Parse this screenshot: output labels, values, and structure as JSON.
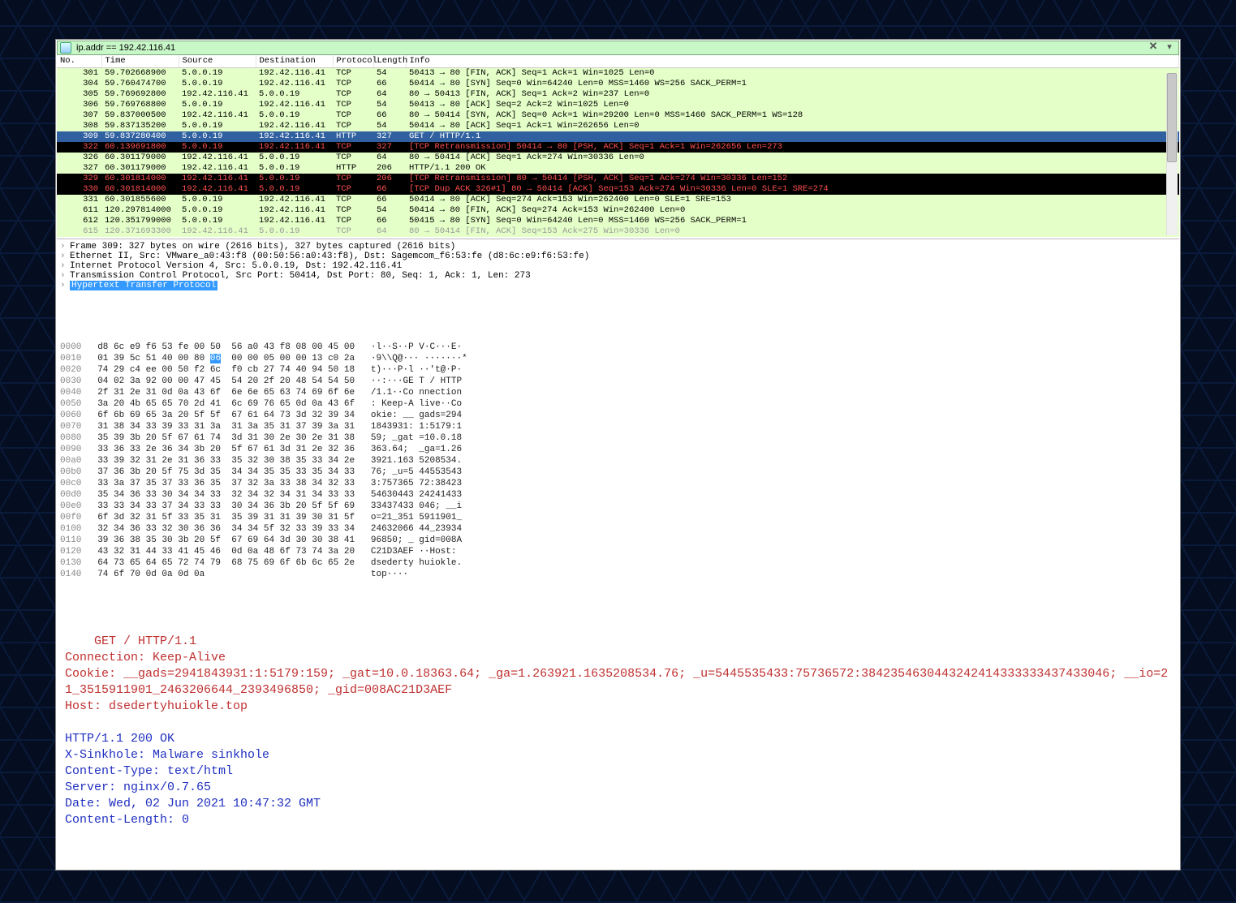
{
  "filter": {
    "text": "ip.addr == 192.42.116.41"
  },
  "columns": {
    "no": "No.",
    "time": "Time",
    "source": "Source",
    "destination": "Destination",
    "protocol": "Protocol",
    "length": "Length",
    "info": "Info"
  },
  "packets": [
    {
      "no": "301",
      "time": "59.702668900",
      "src": "5.0.0.19",
      "dst": "192.42.116.41",
      "proto": "TCP",
      "len": "54",
      "info": "50413 → 80 [FIN, ACK] Seq=1 Ack=1 Win=1025 Len=0",
      "cls": "bg-green"
    },
    {
      "no": "304",
      "time": "59.760474700",
      "src": "5.0.0.19",
      "dst": "192.42.116.41",
      "proto": "TCP",
      "len": "66",
      "info": "50414 → 80 [SYN] Seq=0 Win=64240 Len=0 MSS=1460 WS=256 SACK_PERM=1",
      "cls": "bg-green"
    },
    {
      "no": "305",
      "time": "59.769692800",
      "src": "192.42.116.41",
      "dst": "5.0.0.19",
      "proto": "TCP",
      "len": "64",
      "info": "80 → 50413 [FIN, ACK] Seq=1 Ack=2 Win=237 Len=0",
      "cls": "bg-green"
    },
    {
      "no": "306",
      "time": "59.769768800",
      "src": "5.0.0.19",
      "dst": "192.42.116.41",
      "proto": "TCP",
      "len": "54",
      "info": "50413 → 80 [ACK] Seq=2 Ack=2 Win=1025 Len=0",
      "cls": "bg-green"
    },
    {
      "no": "307",
      "time": "59.837000500",
      "src": "192.42.116.41",
      "dst": "5.0.0.19",
      "proto": "TCP",
      "len": "66",
      "info": "80 → 50414 [SYN, ACK] Seq=0 Ack=1 Win=29200 Len=0 MSS=1460 SACK_PERM=1 WS=128",
      "cls": "bg-green"
    },
    {
      "no": "308",
      "time": "59.837135200",
      "src": "5.0.0.19",
      "dst": "192.42.116.41",
      "proto": "TCP",
      "len": "54",
      "info": "50414 → 80 [ACK] Seq=1 Ack=1 Win=262656 Len=0",
      "cls": "bg-green"
    },
    {
      "no": "309",
      "time": "59.837280400",
      "src": "5.0.0.19",
      "dst": "192.42.116.41",
      "proto": "HTTP",
      "len": "327",
      "info": "GET / HTTP/1.1",
      "cls": "bg-sel"
    },
    {
      "no": "322",
      "time": "60.139691800",
      "src": "5.0.0.19",
      "dst": "192.42.116.41",
      "proto": "TCP",
      "len": "327",
      "info": "[TCP Retransmission] 50414 → 80 [PSH, ACK] Seq=1 Ack=1 Win=262656 Len=273",
      "cls": "bg-black"
    },
    {
      "no": "326",
      "time": "60.301179000",
      "src": "192.42.116.41",
      "dst": "5.0.0.19",
      "proto": "TCP",
      "len": "64",
      "info": "80 → 50414 [ACK] Seq=1 Ack=274 Win=30336 Len=0",
      "cls": "bg-green"
    },
    {
      "no": "327",
      "time": "60.301179000",
      "src": "192.42.116.41",
      "dst": "5.0.0.19",
      "proto": "HTTP",
      "len": "206",
      "info": "HTTP/1.1 200 OK",
      "cls": "bg-green"
    },
    {
      "no": "329",
      "time": "60.301814000",
      "src": "192.42.116.41",
      "dst": "5.0.0.19",
      "proto": "TCP",
      "len": "206",
      "info": "[TCP Retransmission] 80 → 50414 [PSH, ACK] Seq=1 Ack=274 Win=30336 Len=152",
      "cls": "bg-black"
    },
    {
      "no": "330",
      "time": "60.301814000",
      "src": "192.42.116.41",
      "dst": "5.0.0.19",
      "proto": "TCP",
      "len": "66",
      "info": "[TCP Dup ACK 326#1] 80 → 50414 [ACK] Seq=153 Ack=274 Win=30336 Len=0 SLE=1 SRE=274",
      "cls": "bg-black"
    },
    {
      "no": "331",
      "time": "60.301855600",
      "src": "5.0.0.19",
      "dst": "192.42.116.41",
      "proto": "TCP",
      "len": "66",
      "info": "50414 → 80 [ACK] Seq=274 Ack=153 Win=262400 Len=0 SLE=1 SRE=153",
      "cls": "bg-green"
    },
    {
      "no": "611",
      "time": "120.297814000",
      "src": "5.0.0.19",
      "dst": "192.42.116.41",
      "proto": "TCP",
      "len": "54",
      "info": "50414 → 80 [FIN, ACK] Seq=274 Ack=153 Win=262400 Len=0",
      "cls": "bg-green"
    },
    {
      "no": "612",
      "time": "120.351799000",
      "src": "5.0.0.19",
      "dst": "192.42.116.41",
      "proto": "TCP",
      "len": "66",
      "info": "50415 → 80 [SYN] Seq=0 Win=64240 Len=0 MSS=1460 WS=256 SACK_PERM=1",
      "cls": "bg-green"
    },
    {
      "no": "615",
      "time": "120.371693300",
      "src": "192.42.116.41",
      "dst": "5.0.0.19",
      "proto": "TCP",
      "len": "64",
      "info": "80 → 50414 [FIN, ACK] Seq=153 Ack=275 Win=30336 Len=0",
      "cls": "bg-cut"
    }
  ],
  "details": {
    "l0": "Frame 309: 327 bytes on wire (2616 bits), 327 bytes captured (2616 bits)",
    "l1": "Ethernet II, Src: VMware_a0:43:f8 (00:50:56:a0:43:f8), Dst: Sagemcom_f6:53:fe (d8:6c:e9:f6:53:fe)",
    "l2": "Internet Protocol Version 4, Src: 5.0.0.19, Dst: 192.42.116.41",
    "l3": "Transmission Control Protocol, Src Port: 50414, Dst Port: 80, Seq: 1, Ack: 1, Len: 273",
    "l4": "Hypertext Transfer Protocol"
  },
  "hex": [
    {
      "off": "0000",
      "b": "d8 6c e9 f6 53 fe 00 50  56 a0 43 f8 08 00 45 00",
      "a": "·l··S··P V·C···E·"
    },
    {
      "off": "0010",
      "b1": "01 39 5c 51 40 00 80 ",
      "sel": "06",
      "b2": "  00 00 05 00 00 13 c0 2a",
      "a": "·9\\\\Q@··· ·······*"
    },
    {
      "off": "0020",
      "b": "74 29 c4 ee 00 50 f2 6c  f0 cb 27 74 40 94 50 18",
      "a": "t)···P·l ··'t@·P·"
    },
    {
      "off": "0030",
      "b": "04 02 3a 92 00 00 47 45  54 20 2f 20 48 54 54 50",
      "a": "··:···GE T / HTTP"
    },
    {
      "off": "0040",
      "b": "2f 31 2e 31 0d 0a 43 6f  6e 6e 65 63 74 69 6f 6e",
      "a": "/1.1··Co nnection"
    },
    {
      "off": "0050",
      "b": "3a 20 4b 65 65 70 2d 41  6c 69 76 65 0d 0a 43 6f",
      "a": ": Keep-A live··Co"
    },
    {
      "off": "0060",
      "b": "6f 6b 69 65 3a 20 5f 5f  67 61 64 73 3d 32 39 34",
      "a": "okie: __ gads=294"
    },
    {
      "off": "0070",
      "b": "31 38 34 33 39 33 31 3a  31 3a 35 31 37 39 3a 31",
      "a": "1843931: 1:5179:1"
    },
    {
      "off": "0080",
      "b": "35 39 3b 20 5f 67 61 74  3d 31 30 2e 30 2e 31 38",
      "a": "59; _gat =10.0.18"
    },
    {
      "off": "0090",
      "b": "33 36 33 2e 36 34 3b 20  5f 67 61 3d 31 2e 32 36",
      "a": "363.64;  _ga=1.26"
    },
    {
      "off": "00a0",
      "b": "33 39 32 31 2e 31 36 33  35 32 30 38 35 33 34 2e",
      "a": "3921.163 5208534."
    },
    {
      "off": "00b0",
      "b": "37 36 3b 20 5f 75 3d 35  34 34 35 35 33 35 34 33",
      "a": "76; _u=5 44553543"
    },
    {
      "off": "00c0",
      "b": "33 3a 37 35 37 33 36 35  37 32 3a 33 38 34 32 33",
      "a": "3:757365 72:38423"
    },
    {
      "off": "00d0",
      "b": "35 34 36 33 30 34 34 33  32 34 32 34 31 34 33 33",
      "a": "54630443 24241433"
    },
    {
      "off": "00e0",
      "b": "33 33 34 33 37 34 33 33  30 34 36 3b 20 5f 5f 69",
      "a": "33437433 046; __i"
    },
    {
      "off": "00f0",
      "b": "6f 3d 32 31 5f 33 35 31  35 39 31 31 39 30 31 5f",
      "a": "o=21_351 5911901_"
    },
    {
      "off": "0100",
      "b": "32 34 36 33 32 30 36 36  34 34 5f 32 33 39 33 34",
      "a": "24632066 44_23934"
    },
    {
      "off": "0110",
      "b": "39 36 38 35 30 3b 20 5f  67 69 64 3d 30 30 38 41",
      "a": "96850; _ gid=008A"
    },
    {
      "off": "0120",
      "b": "43 32 31 44 33 41 45 46  0d 0a 48 6f 73 74 3a 20",
      "a": "C21D3AEF ··Host: "
    },
    {
      "off": "0130",
      "b": "64 73 65 64 65 72 74 79  68 75 69 6f 6b 6c 65 2e",
      "a": "dsederty huiokle."
    },
    {
      "off": "0140",
      "b": "74 6f 70 0d 0a 0d 0a",
      "a": "top····"
    }
  ],
  "stream": {
    "req": "GET / HTTP/1.1\nConnection: Keep-Alive\nCookie: __gads=2941843931:1:5179:159; _gat=10.0.18363.64; _ga=1.263921.1635208534.76; _u=5445535433:75736572:3842354630443242414333333437433046; __io=21_3515911901_2463206644_2393496850; _gid=008AC21D3AEF\nHost: dsedertyhuiokle.top\n",
    "res": "HTTP/1.1 200 OK\nX-Sinkhole: Malware sinkhole\nContent-Type: text/html\nServer: nginx/0.7.65\nDate: Wed, 02 Jun 2021 10:47:32 GMT\nContent-Length: 0\n"
  }
}
